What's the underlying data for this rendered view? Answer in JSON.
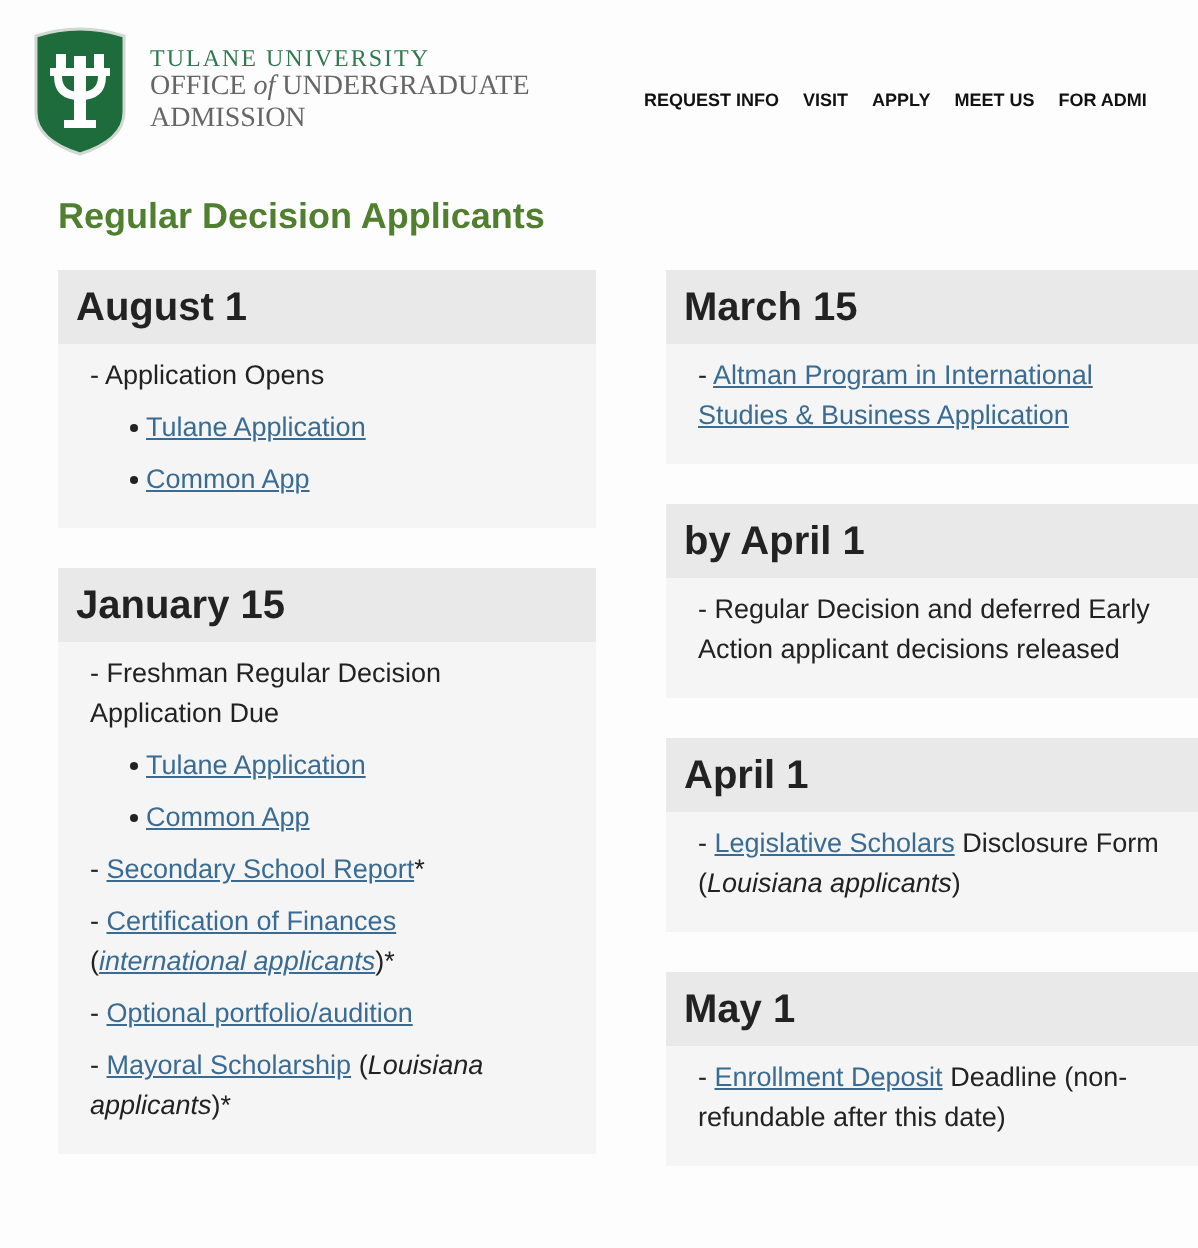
{
  "header": {
    "kicker": "TULANE UNIVERSITY",
    "office_line_1": [
      {
        "text": "OFFICE ",
        "kind": "plain"
      },
      {
        "text": "of",
        "kind": "italic"
      },
      {
        "text": " UNDERGRADUATE",
        "kind": "plain"
      }
    ],
    "office_line_2": "ADMISSION",
    "nav": [
      "REQUEST INFO",
      "VISIT",
      "APPLY",
      "MEET US",
      "FOR ADMI"
    ]
  },
  "page_title": "Regular Decision Applicants",
  "columns": [
    [
      {
        "date": "August 1",
        "items": [
          {
            "kind": "text",
            "segments": [
              {
                "text": "- Application Opens",
                "kind": "plain"
              }
            ]
          },
          {
            "kind": "bullet",
            "segments": [
              {
                "text": "Tulane Application",
                "kind": "link"
              }
            ]
          },
          {
            "kind": "bullet",
            "segments": [
              {
                "text": "Common App",
                "kind": "link"
              }
            ]
          }
        ]
      },
      {
        "date": "January 15",
        "items": [
          {
            "kind": "text",
            "segments": [
              {
                "text": "- Freshman Regular Decision Application Due",
                "kind": "plain"
              }
            ]
          },
          {
            "kind": "bullet",
            "segments": [
              {
                "text": "Tulane Application",
                "kind": "link"
              }
            ]
          },
          {
            "kind": "bullet",
            "segments": [
              {
                "text": "Common App",
                "kind": "link"
              }
            ]
          },
          {
            "kind": "text",
            "segments": [
              {
                "text": "- ",
                "kind": "plain"
              },
              {
                "text": "Secondary School Report",
                "kind": "link"
              },
              {
                "text": "*",
                "kind": "plain"
              }
            ]
          },
          {
            "kind": "text",
            "segments": [
              {
                "text": "- ",
                "kind": "plain"
              },
              {
                "text": "Certification of Finances",
                "kind": "link"
              },
              {
                "kind": "break"
              },
              {
                "text": "(",
                "kind": "plain"
              },
              {
                "text": "international applicants",
                "kind": "italic-link"
              },
              {
                "text": ")*",
                "kind": "plain"
              }
            ]
          },
          {
            "kind": "text",
            "segments": [
              {
                "text": "- ",
                "kind": "plain"
              },
              {
                "text": "Optional portfolio/audition",
                "kind": "link"
              }
            ]
          },
          {
            "kind": "text",
            "segments": [
              {
                "text": "- ",
                "kind": "plain"
              },
              {
                "text": "Mayoral Scholarship",
                "kind": "link"
              },
              {
                "text": " (",
                "kind": "plain"
              },
              {
                "text": "Louisiana applicants",
                "kind": "italic"
              },
              {
                "text": ")*",
                "kind": "plain"
              }
            ]
          }
        ]
      }
    ],
    [
      {
        "date": "March 15",
        "items": [
          {
            "kind": "text",
            "segments": [
              {
                "text": "- ",
                "kind": "plain"
              },
              {
                "text": "Altman Program in International",
                "kind": "link"
              },
              {
                "kind": "break"
              },
              {
                "text": "Studies & Business Application",
                "kind": "link"
              }
            ]
          }
        ]
      },
      {
        "date": "by April 1",
        "items": [
          {
            "kind": "text",
            "segments": [
              {
                "text": "- Regular Decision and deferred Early Action applicant decisions released",
                "kind": "plain"
              }
            ]
          }
        ]
      },
      {
        "date": "April 1",
        "items": [
          {
            "kind": "text",
            "segments": [
              {
                "text": "- ",
                "kind": "plain"
              },
              {
                "text": "Legislative Scholars",
                "kind": "link"
              },
              {
                "text": " Disclosure Form (",
                "kind": "plain"
              },
              {
                "text": "Louisiana applicants",
                "kind": "italic"
              },
              {
                "text": ")",
                "kind": "plain"
              }
            ]
          }
        ]
      },
      {
        "date": "May 1",
        "items": [
          {
            "kind": "text",
            "segments": [
              {
                "text": "- ",
                "kind": "plain"
              },
              {
                "text": "Enrollment Deposit",
                "kind": "link"
              },
              {
                "text": " Deadline (non-refundable after this date)",
                "kind": "plain"
              }
            ]
          }
        ]
      }
    ]
  ]
}
